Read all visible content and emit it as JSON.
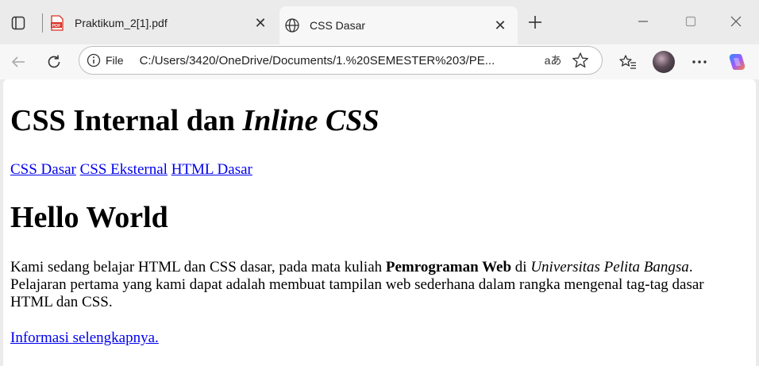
{
  "tabs": [
    {
      "title": "Praktikum_2[1].pdf",
      "icon": "pdf-icon",
      "active": false
    },
    {
      "title": "CSS Dasar",
      "icon": "globe-icon",
      "active": true
    }
  ],
  "toolbar": {
    "site_info_label": "File",
    "url": "C:/Users/3420/OneDrive/Documents/1.%20SEMESTER%203/PE...",
    "read_aloud_glyph": "aあ"
  },
  "page": {
    "heading1_plain": "CSS Internal dan ",
    "heading1_italic": "Inline CSS",
    "nav_links": [
      "CSS Dasar",
      "CSS Eksternal",
      "HTML Dasar"
    ],
    "heading2": "Hello World",
    "paragraph": {
      "part1": "Kami sedang belajar HTML dan CSS dasar, pada mata kuliah ",
      "bold": "Pemrograman Web",
      "part2": " di ",
      "italic": "Universitas Pelita Bangsa",
      "part3": ". Pelajaran pertama yang kami dapat adalah membuat tampilan web sederhana dalam rangka mengenal tag-tag dasar HTML dan CSS."
    },
    "more_link": "Informasi selengkapnya."
  },
  "colors": {
    "link": "#0000ee",
    "pdf_red": "#d93025",
    "copilot": "#7b61ff"
  }
}
